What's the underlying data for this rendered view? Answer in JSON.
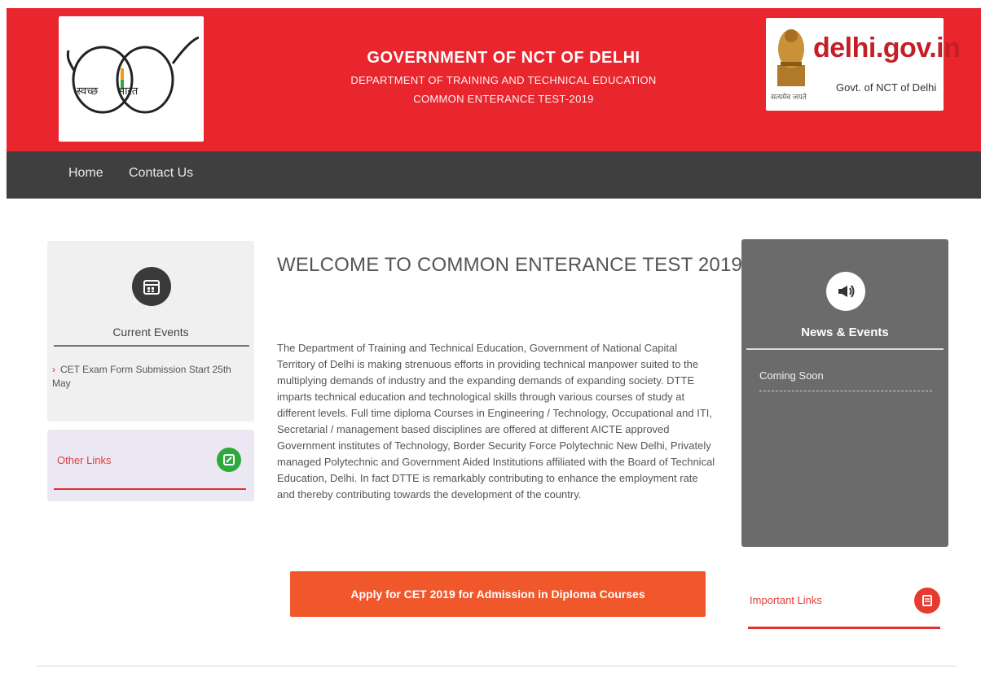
{
  "header": {
    "title": "GOVERNMENT OF NCT OF DELHI",
    "department": "DEPARTMENT OF TRAINING AND TECHNICAL EDUCATION",
    "subtitle": "COMMON ENTERANCE TEST-2019",
    "left_logo_text_a": "स्वच्छ",
    "left_logo_text_b": "भारत",
    "right_logo_main": "delhi.gov.in",
    "right_logo_sub": "Govt. of NCT of Delhi",
    "right_logo_emblem_caption": "सत्यमेव जयते"
  },
  "nav": {
    "home": "Home",
    "contact": "Contact Us"
  },
  "sidebar_left": {
    "current_events_title": "Current Events",
    "current_events_item": "CET Exam Form Submission Start 25th May",
    "other_links_label": "Other Links"
  },
  "main": {
    "welcome_title": "WELCOME TO COMMON ENTERANCE TEST 2019",
    "welcome_body": "The Department of Training and Technical Education, Government of National Capital Territory of Delhi is making strenuous efforts in providing technical manpower suited to the multiplying demands of industry and the expanding demands of expanding society. DTTE imparts technical education and technological skills through various courses of study at different levels. Full time diploma Courses in Engineering / Technology, Occupational and ITI, Secretarial / management based disciplines are offered at different AICTE approved Government institutes of Technology, Border Security Force Polytechnic New Delhi, Privately managed Polytechnic and Government Aided Institutions affiliated with the Board of Technical Education, Delhi. In fact DTTE is remarkably contributing to enhance the employment rate and thereby contributing towards the development of the country.",
    "apply_button": "Apply for CET 2019 for Admission in Diploma Courses"
  },
  "sidebar_right": {
    "news_title": "News & Events",
    "news_item": "Coming Soon",
    "important_links_label": "Important Links"
  },
  "colors": {
    "header_red": "#e9252d",
    "nav_dark": "#3f3f3f",
    "apply_orange": "#f0572a",
    "news_gray": "#6b6b6b",
    "accent_red": "#e03030",
    "green_icon": "#2eaa3c"
  },
  "icons": {
    "current_events": "calendar-icon",
    "other_links": "link-icon",
    "news": "megaphone-icon",
    "important_links": "document-icon"
  }
}
